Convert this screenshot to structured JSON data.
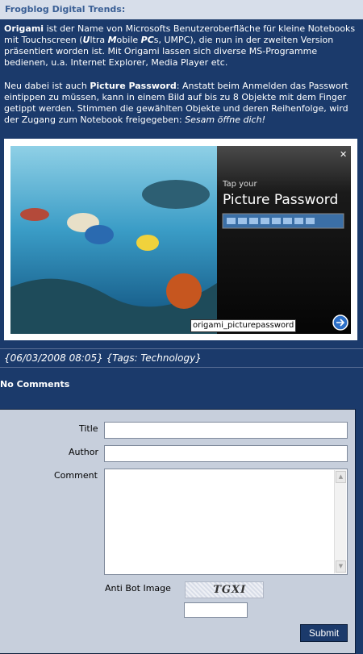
{
  "header": {
    "title": "Frogblog Digital Trends:"
  },
  "post": {
    "p1": {
      "origami": "Origami",
      "t1": " ist der Name von Microsofts Benutzeroberfläche für kleine Notebooks mit Touchscreen (",
      "u": "U",
      "ltra": "ltra ",
      "m": "M",
      "obile": "obile ",
      "pcs": "PC",
      "t2": "s, UMPC), die nun in der zweiten Version präsentiert worden ist. Mit Origami lassen sich diverse MS-Programme bedienen, u.a. Internet Explorer, Media Player etc."
    },
    "p2": {
      "t1": "Neu dabei ist auch ",
      "pp": "Picture Password",
      "t2": ": Anstatt beim Anmelden das Passwort eintippen zu müssen, kann in einem Bild auf bis zu 8 Objekte mit dem Finger getippt werden. Stimmen die gewählten Objekte und deren Reihenfolge, wird der Zugang zum Notebook freigegeben: ",
      "sesam": "Sesam öffne dich!"
    },
    "image": {
      "tap_your": "Tap your",
      "picture_password": "Picture Password",
      "tooltip": "origami_picturepassword",
      "close": "✕"
    },
    "meta": "{06/03/2008 08:05} {Tags: Technology}"
  },
  "comments": {
    "heading": "No Comments"
  },
  "form": {
    "title_label": "Title",
    "author_label": "Author",
    "comment_label": "Comment",
    "antibot_label": "Anti Bot Image",
    "captcha_text": "TGXI",
    "submit_label": "Submit"
  }
}
